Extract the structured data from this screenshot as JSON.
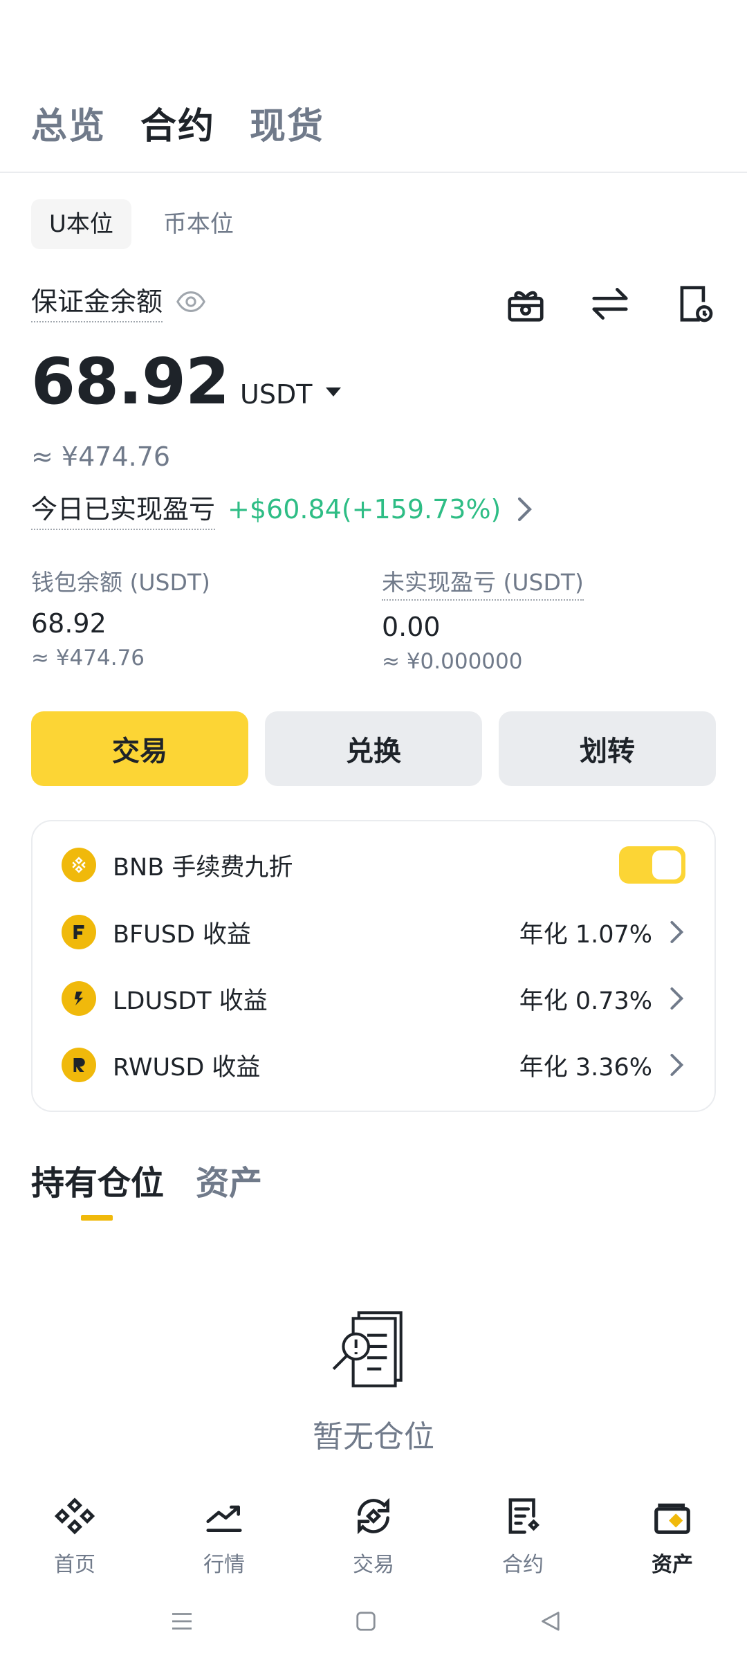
{
  "top_tabs": [
    "总览",
    "合约",
    "现货"
  ],
  "sub_tabs": [
    "U本位",
    "币本位"
  ],
  "margin_balance_label": "保证金余额",
  "balance": {
    "amount": "68.92",
    "unit": "USDT",
    "approx": "≈ ¥474.76"
  },
  "pnl": {
    "label": "今日已实现盈亏",
    "value": "+$60.84(+159.73%)"
  },
  "stats": {
    "wallet": {
      "label": "钱包余额 (USDT)",
      "value": "68.92",
      "approx": "≈ ¥474.76"
    },
    "unrealized": {
      "label": "未实现盈亏 (USDT)",
      "value": "0.00",
      "approx": "≈ ¥0.000000"
    }
  },
  "buttons": {
    "trade": "交易",
    "convert": "兑换",
    "transfer": "划转"
  },
  "earn": {
    "bnb_fee": {
      "label": "BNB 手续费九折",
      "enabled": true
    },
    "rows": [
      {
        "name": "BFUSD 收益",
        "rate": "年化 1.07%"
      },
      {
        "name": "LDUSDT 收益",
        "rate": "年化 0.73%"
      },
      {
        "name": "RWUSD 收益",
        "rate": "年化 3.36%"
      }
    ]
  },
  "position_tabs": [
    "持有仓位",
    "资产"
  ],
  "empty_text": "暂无仓位",
  "nav": [
    "首页",
    "行情",
    "交易",
    "合约",
    "资产"
  ],
  "colors": {
    "brand_yellow": "#FCD535",
    "profit_green": "#2EBD85",
    "text_primary": "#1E2329",
    "text_secondary": "#707A8A"
  },
  "icons": {
    "top_actions": [
      "gift-icon",
      "swap-arrows-icon",
      "history-clock-icon"
    ],
    "coins": [
      "bnb-coin-icon",
      "bfusd-coin-icon",
      "ldusdt-coin-icon",
      "rwusd-coin-icon"
    ]
  }
}
